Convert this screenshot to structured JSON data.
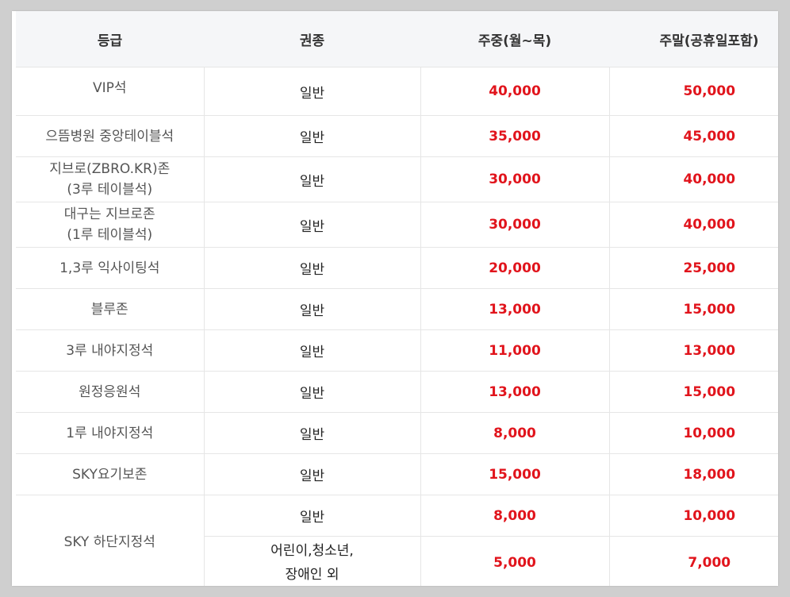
{
  "header": {
    "grade": "등급",
    "ticket_type": "권종",
    "weekday": "주중(월~목)",
    "weekend": "주말(공휴일포함)"
  },
  "rows": [
    {
      "grade": "VIP석",
      "type": "일반",
      "weekday": "40,000",
      "weekend": "50,000"
    },
    {
      "grade": "으뜸병원 중앙테이블석",
      "type": "일반",
      "weekday": "35,000",
      "weekend": "45,000"
    },
    {
      "grade_line1": "지브로(ZBRO.KR)존",
      "grade_line2": "(3루 테이블석)",
      "type": "일반",
      "weekday": "30,000",
      "weekend": "40,000"
    },
    {
      "grade_line1": "대구는 지브로존",
      "grade_line2": "(1루 테이블석)",
      "type": "일반",
      "weekday": "30,000",
      "weekend": "40,000"
    },
    {
      "grade": "1,3루 익사이팅석",
      "type": "일반",
      "weekday": "20,000",
      "weekend": "25,000"
    },
    {
      "grade": "블루존",
      "type": "일반",
      "weekday": "13,000",
      "weekend": "15,000"
    },
    {
      "grade": "3루 내야지정석",
      "type": "일반",
      "weekday": "11,000",
      "weekend": "13,000"
    },
    {
      "grade": "원정응원석",
      "type": "일반",
      "weekday": "13,000",
      "weekend": "15,000"
    },
    {
      "grade": "1루 내야지정석",
      "type": "일반",
      "weekday": "8,000",
      "weekend": "10,000"
    },
    {
      "grade": "SKY요기보존",
      "type": "일반",
      "weekday": "15,000",
      "weekend": "18,000"
    },
    {
      "grade": "SKY 하단지정석",
      "type": "일반",
      "weekday": "8,000",
      "weekend": "10,000"
    },
    {
      "type_line1": "어린이,청소년,",
      "type_line2": "장애인 외",
      "weekday": "5,000",
      "weekend": "7,000"
    }
  ],
  "colors": {
    "price": "#e1141c",
    "header_bg": "#f5f6f8",
    "page_bg": "#cfcfcf"
  }
}
